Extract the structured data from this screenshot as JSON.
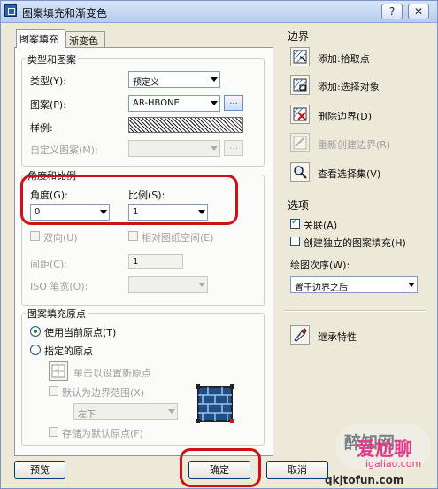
{
  "window": {
    "title": "图案填充和渐变色"
  },
  "titlebar": {
    "help": "?",
    "close": "✕"
  },
  "tabs": [
    "图案填充",
    "渐变色"
  ],
  "type_pattern": {
    "group_title": "类型和图案",
    "type_label": "类型(Y):",
    "type_value": "预定义",
    "pattern_label": "图案(P):",
    "pattern_value": "AR-HBONE",
    "browse": "...",
    "sample_label": "样例:",
    "custom_label": "自定义图案(M):",
    "custom_browse": "..."
  },
  "angle_scale": {
    "group_title": "角度和比例",
    "angle_label": "角度(G):",
    "angle_value": "0",
    "scale_label": "比例(S):",
    "scale_value": "1",
    "double_label": "双向(U)",
    "relative_label": "相对图纸空间(E)",
    "spacing_label": "间距(C):",
    "spacing_value": "1",
    "iso_label": "ISO 笔宽(O):"
  },
  "origin": {
    "group_title": "图案填充原点",
    "use_current": "使用当前原点(T)",
    "specified": "指定的原点",
    "click_set": "单击以设置新原点",
    "default_extent": "默认为边界范围(X)",
    "position_value": "左下",
    "store_default": "存储为默认原点(F)"
  },
  "boundary": {
    "group_title": "边界",
    "add_pick": "添加:拾取点",
    "add_select": "添加:选择对象",
    "remove": "删除边界(D)",
    "recreate": "重新创建边界(R)",
    "view_selection": "查看选择集(V)"
  },
  "options": {
    "group_title": "选项",
    "associative": "关联(A)",
    "create_separate": "创建独立的图案填充(H)",
    "draw_order_label": "绘图次序(W):",
    "draw_order_value": "置于边界之后"
  },
  "inherit": "继承特性",
  "buttons": {
    "preview": "预览",
    "ok": "确定",
    "cancel": "取消"
  },
  "watermark": {
    "brand": "爱尬聊",
    "domain": "igaliao.com",
    "bottom": "qkjtofun.com",
    "text": "醉知网"
  }
}
